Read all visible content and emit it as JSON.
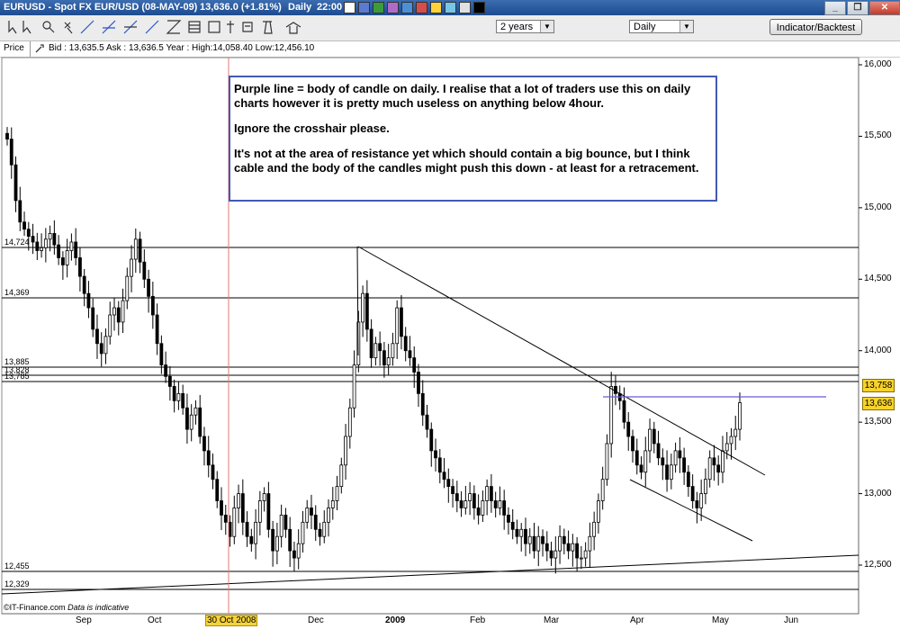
{
  "window": {
    "title": "EURUSD - Spot FX EUR/USD (08-MAY-09)",
    "last": "13,636.0 (+1.81%)",
    "interval": "Daily",
    "time": "22:00"
  },
  "toolbar": {
    "period_value": "2 years",
    "interval_value": "Daily",
    "indicator_button": "Indicator/Backtest"
  },
  "infobar": {
    "price_label": "Price",
    "quote": "Bid : 13,635.5 Ask : 13,636.5  Year : High:14,058.40 Low:12,456.10"
  },
  "note": {
    "p1": "Purple line = body of candle on daily. I realise that a lot of traders use this on daily charts however it is pretty much useless on anything below 4hour.",
    "p2": "Ignore the crosshair please.",
    "p3": "It's not at the area of resistance yet which should contain a big bounce, but I think cable and the body of the candles might push this down - at least for a retracement."
  },
  "footer": {
    "brand": "©IT-Finance.com",
    "disclaimer": "Data is indicative"
  },
  "colors": {
    "candle_up": "#ffffff",
    "candle_down": "#000000",
    "purple_line": "#6b5bd6",
    "crosshair": "#e07a7a",
    "note_border": "#4259b5",
    "badge": "#f7d22a"
  },
  "chart_data": {
    "type": "candlestick",
    "symbol": "EURUSD",
    "y_axis_ticks": [
      "16,000",
      "15,500",
      "15,000",
      "14,500",
      "14,000",
      "13,500",
      "13,000",
      "12,500"
    ],
    "x_axis_ticks": [
      "Sep",
      "Oct",
      "30 Oct 2008",
      "Dec",
      "2009",
      "Feb",
      "Mar",
      "Apr",
      "May",
      "Jun"
    ],
    "ylim": [
      12200,
      16100
    ],
    "horizontal_levels": [
      {
        "label": "14,724",
        "value": 14724
      },
      {
        "label": "14,369",
        "value": 14369
      },
      {
        "label": "13,885",
        "value": 13885
      },
      {
        "label": "13,828",
        "value": 13828
      },
      {
        "label": "13,785",
        "value": 13785
      },
      {
        "label": "12,455",
        "value": 12455
      },
      {
        "label": "12,329",
        "value": 12329
      }
    ],
    "price_badges": [
      {
        "label": "13,758",
        "value": 13758
      },
      {
        "label": "13,636",
        "value": 13636
      }
    ],
    "purple_line_value": 13680,
    "close_series": [
      15480,
      15300,
      15050,
      14900,
      14850,
      14800,
      14760,
      14700,
      14720,
      14780,
      14820,
      14740,
      14650,
      14600,
      14700,
      14760,
      14650,
      14520,
      14400,
      14300,
      14150,
      14050,
      13980,
      14100,
      14250,
      14300,
      14200,
      14350,
      14520,
      14640,
      14780,
      14620,
      14500,
      14380,
      14250,
      14050,
      13900,
      13820,
      13750,
      13650,
      13700,
      13600,
      13450,
      13550,
      13600,
      13400,
      13300,
      13200,
      13100,
      12950,
      12850,
      12800,
      12700,
      12900,
      13000,
      12800,
      12700,
      12650,
      12800,
      12950,
      13000,
      12750,
      12600,
      12700,
      12850,
      12750,
      12600,
      12550,
      12650,
      12800,
      12900,
      12850,
      12750,
      12700,
      12800,
      12900,
      12950,
      13050,
      13200,
      13400,
      13600,
      13900,
      14200,
      14400,
      14150,
      13950,
      14050,
      14000,
      13900,
      13950,
      14050,
      14300,
      14100,
      14000,
      13950,
      13850,
      13700,
      13550,
      13450,
      13300,
      13250,
      13150,
      13100,
      13050,
      13000,
      12950,
      12900,
      12950,
      13000,
      12900,
      12850,
      12950,
      13050,
      12950,
      12900,
      12950,
      12850,
      12800,
      12750,
      12700,
      12750,
      12650,
      12700,
      12600,
      12700,
      12650,
      12600,
      12550,
      12600,
      12700,
      12650,
      12600,
      12650,
      12550,
      12550,
      12600,
      12700,
      12800,
      12950,
      13100,
      13350,
      13750,
      13700,
      13650,
      13500,
      13400,
      13300,
      13200,
      13150,
      13300,
      13450,
      13350,
      13250,
      13200,
      13100,
      13200,
      13300,
      13250,
      13150,
      13050,
      12950,
      12900,
      13000,
      13100,
      13250,
      13200,
      13150,
      13300,
      13350,
      13400,
      13450,
      13636
    ]
  }
}
